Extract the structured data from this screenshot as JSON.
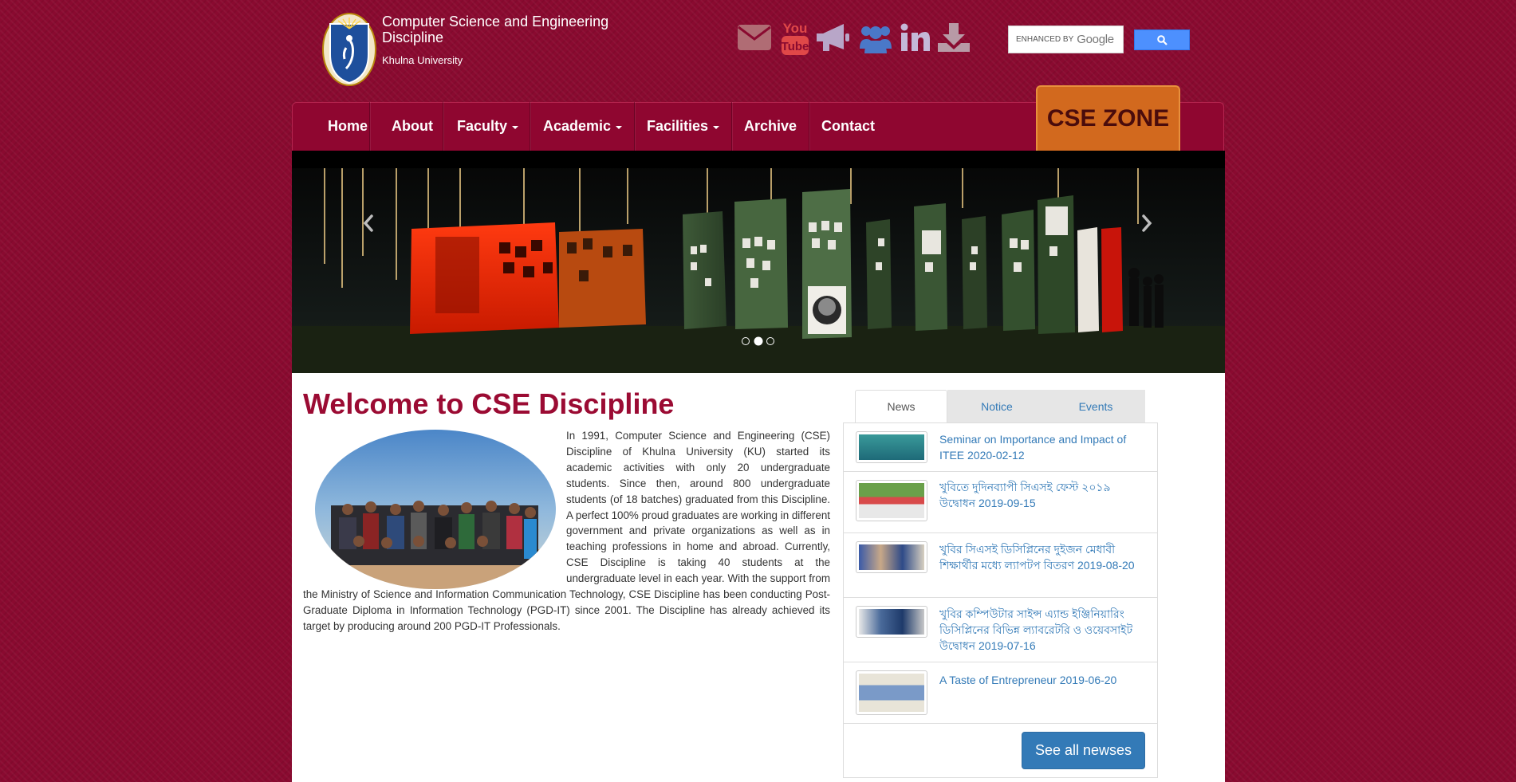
{
  "header": {
    "site_title": "Computer Science and Engineering Discipline",
    "site_subtitle": "Khulna University"
  },
  "social_icons": [
    "envelope-icon",
    "youtube-icon",
    "bullhorn-icon",
    "users-icon",
    "linkedin-icon",
    "download-icon"
  ],
  "search": {
    "placeholder_prefix": "ENHANCED BY",
    "placeholder_brand": "Google"
  },
  "nav": {
    "items": [
      {
        "label": "Home",
        "dropdown": false
      },
      {
        "label": "About",
        "dropdown": false
      },
      {
        "label": "Faculty",
        "dropdown": true
      },
      {
        "label": "Academic",
        "dropdown": true
      },
      {
        "label": "Facilities",
        "dropdown": true
      },
      {
        "label": "Archive",
        "dropdown": false
      },
      {
        "label": "Contact",
        "dropdown": false
      }
    ],
    "cse_zone": "CSE ZONE"
  },
  "carousel": {
    "slide_count": 3,
    "active_index": 1
  },
  "welcome": {
    "title": "Welcome to CSE Discipline",
    "body": "In 1991, Computer Science and Engineering (CSE) Discipline of Khulna University (KU) started its academic activities with only 20 undergraduate students. Since then, around 800 undergraduate students (of 18 batches) graduated from this Discipline. A perfect 100% proud graduates are working in different government and private organizations as well as in teaching professions in home and abroad. Currently, CSE Discipline is taking 40 students at the undergraduate level in each year. With the support from the Ministry of Science and Information Communication Technology, CSE Discipline has been conducting Post-Graduate Diploma in Information Technology (PGD-IT) since 2001. The Discipline has already achieved its target by producing around 200 PGD-IT Professionals."
  },
  "tabs": [
    "News",
    "Notice",
    "Events"
  ],
  "news": [
    {
      "title": "Seminar on Importance and Impact of ITEE 2020-02-12"
    },
    {
      "title": "খুবিতে দুদিনব্যাপী সিএসই ফেস্ট ২০১৯ উদ্বোধন 2019-09-15"
    },
    {
      "title": "খুবির সিএসই ডিসিপ্লিনের দুইজন মেধাবী শিক্ষার্থীর মধ্যে ল্যাপটপ বিতরণ 2019-08-20"
    },
    {
      "title": "খুবির কম্পিউটার সাইন্স এ্যান্ড ইঞ্জিনিয়ারিং ডিসিপ্লিনের বিভিন্ন ল্যাবরেটরি ও ওয়েবসাইট উদ্বোধন 2019-07-16"
    },
    {
      "title": "A Taste of Entrepreneur 2019-06-20"
    }
  ],
  "see_all_label": "See all newses",
  "colors": {
    "brand_maroon": "#8f0630",
    "title_red": "#9b0b33",
    "cse_zone_orange": "#d2691e",
    "link_blue": "#337ab7"
  }
}
